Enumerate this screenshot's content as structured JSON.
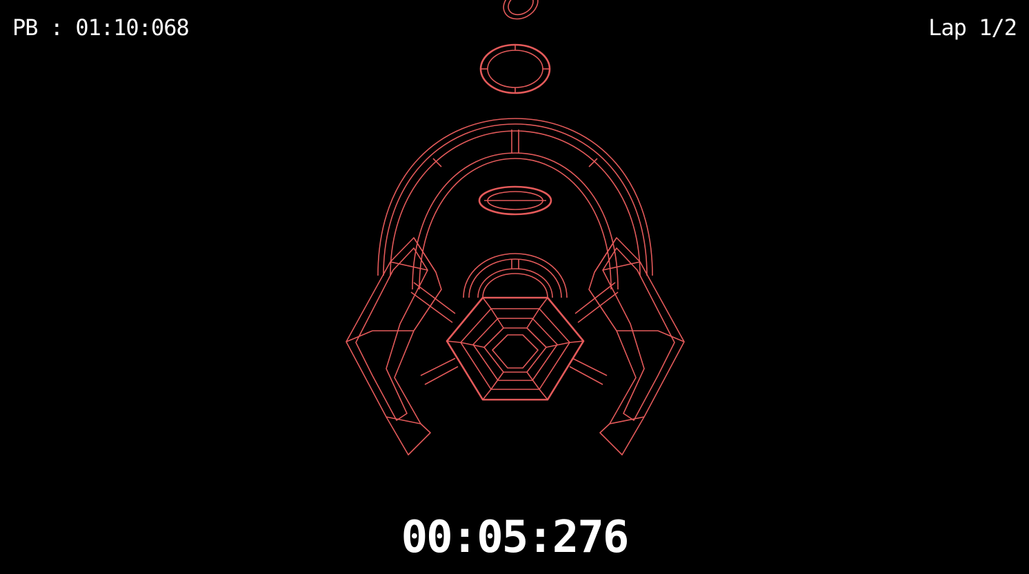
{
  "hud": {
    "personal_best": "PB : 01:10:068",
    "lap": "Lap 1/2",
    "timer": "00:05:276"
  },
  "colors": {
    "background": "#000000",
    "wireframe": "#e45a5a",
    "hud_text": "#ffffff"
  },
  "scene": {
    "track_rings": [
      "far-ring",
      "near-ring",
      "inner-ring",
      "arch-gate"
    ],
    "player_ship": "wireframe-hexagonal-ship"
  }
}
